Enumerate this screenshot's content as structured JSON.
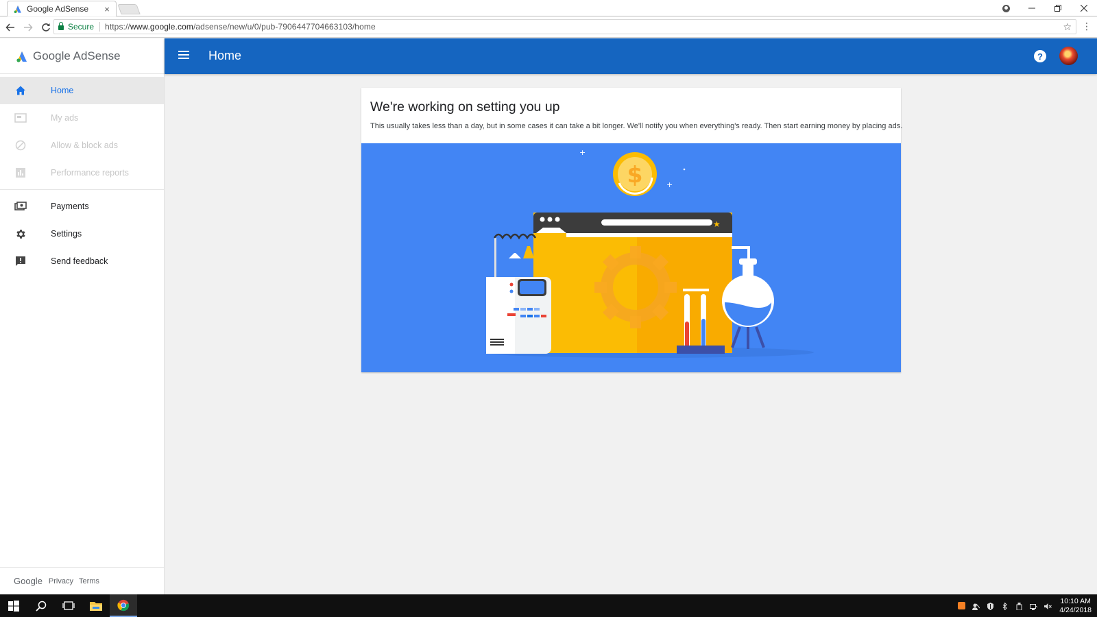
{
  "browser": {
    "tab_title": "Google AdSense",
    "tab_close": "×",
    "secure_label": "Secure",
    "url_scheme": "https://",
    "url_host": "www.google.com",
    "url_path": "/adsense/new/u/0/pub-7906447704663103/home"
  },
  "app": {
    "brand_google": "Google",
    "brand_product": "AdSense",
    "page_title": "Home",
    "help_label": "?"
  },
  "sidebar": {
    "items": [
      {
        "label": "Home",
        "icon": "home-icon",
        "state": "active"
      },
      {
        "label": "My ads",
        "icon": "ads-icon",
        "state": "disabled"
      },
      {
        "label": "Allow & block ads",
        "icon": "block-icon",
        "state": "disabled"
      },
      {
        "label": "Performance reports",
        "icon": "bar-chart-icon",
        "state": "disabled"
      },
      {
        "label": "Payments",
        "icon": "payments-icon",
        "state": "normal"
      },
      {
        "label": "Settings",
        "icon": "gear-icon",
        "state": "normal"
      },
      {
        "label": "Send feedback",
        "icon": "feedback-icon",
        "state": "normal"
      }
    ],
    "footer": {
      "google": "Google",
      "privacy": "Privacy",
      "terms": "Terms"
    }
  },
  "card": {
    "title": "We're working on setting you up",
    "description": "This usually takes less than a day, but in some cases it can take a bit longer. We'll notify you when everything's ready. Then start earning money by placing ads.",
    "coin_symbol": "$"
  },
  "taskbar": {
    "time": "10:10 AM",
    "date": "4/24/2018"
  },
  "colors": {
    "appbar": "#1565c0",
    "hero": "#4285f4",
    "active_nav": "#1a73e8"
  }
}
